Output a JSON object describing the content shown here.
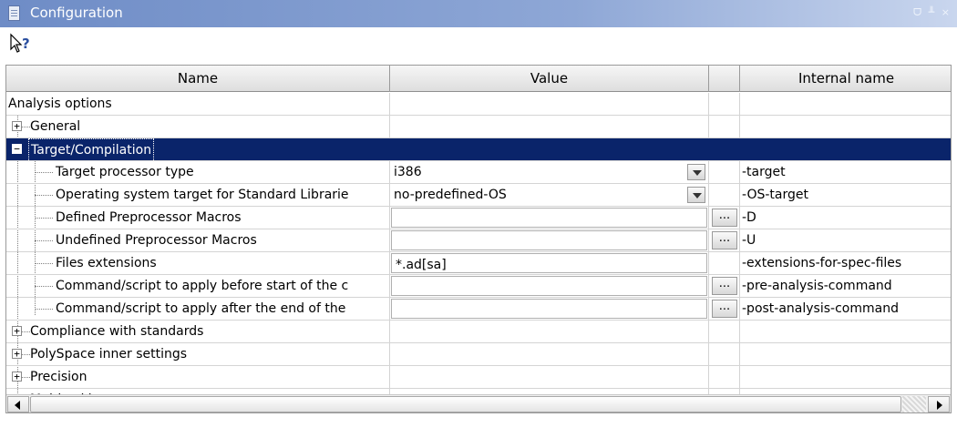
{
  "window": {
    "title": "Configuration",
    "controls": "ᗜ ╨ ×"
  },
  "toolbar": {
    "help_icon": "context-help-icon"
  },
  "columns": {
    "name": "Name",
    "value": "Value",
    "extra": "",
    "internal": "Internal name"
  },
  "rows": {
    "analysis_options": {
      "name": "Analysis options"
    },
    "general": {
      "name": "General",
      "expander": "+"
    },
    "target_compilation": {
      "name": "Target/Compilation",
      "expander": "−"
    },
    "target_processor": {
      "name": "Target processor type",
      "value": "i386",
      "internal": "-target"
    },
    "os_target": {
      "name": "Operating system target for Standard Librarie",
      "value": "no-predefined-OS",
      "internal": "-OS-target"
    },
    "defined_macros": {
      "name": "Defined Preprocessor Macros",
      "button": "...",
      "internal": "-D"
    },
    "undefined_macros": {
      "name": "Undefined Preprocessor Macros",
      "button": "...",
      "internal": "-U"
    },
    "files_ext": {
      "name": "Files extensions",
      "value": "*.ad[sa]",
      "internal": "-extensions-for-spec-files"
    },
    "pre_cmd": {
      "name": "Command/script to apply before start of the c",
      "button": "...",
      "internal": "-pre-analysis-command"
    },
    "post_cmd": {
      "name": "Command/script to apply after the end of the",
      "button": "...",
      "internal": "-post-analysis-command"
    },
    "compliance": {
      "name": "Compliance with standards",
      "expander": "+"
    },
    "inner_settings": {
      "name": "PolySpace inner settings",
      "expander": "+"
    },
    "precision": {
      "name": "Precision",
      "expander": "+"
    },
    "multitasking": {
      "name": "Multitasking",
      "expander": "+"
    }
  },
  "colors": {
    "selection": "#0a246a",
    "titlebar": "#6e8cc6"
  }
}
